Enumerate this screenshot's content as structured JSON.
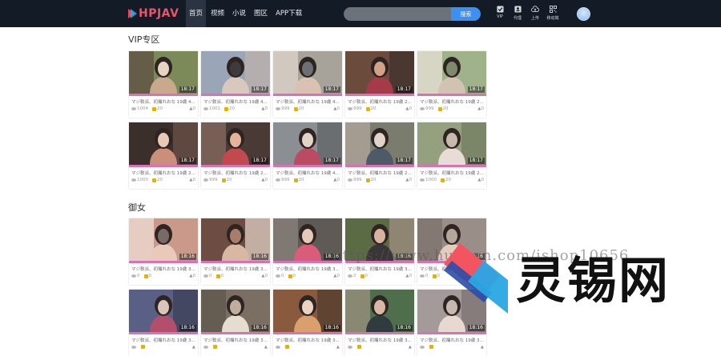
{
  "header": {
    "logo": "HPJAV",
    "nav": [
      "首页",
      "视频",
      "小说",
      "图区",
      "APP下载"
    ],
    "search_placeholder": "",
    "search_button": "搜索",
    "tools": [
      {
        "label": "VIP",
        "icon": "vip-check-icon"
      },
      {
        "label": "代理",
        "icon": "agent-icon"
      },
      {
        "label": "上传",
        "icon": "upload-cloud-icon"
      },
      {
        "label": "移动端",
        "icon": "mobile-qr-icon"
      }
    ]
  },
  "sections": [
    {
      "title": "VIP专区",
      "cards": [
        {
          "duration": "18:17",
          "title": "マジ軟派、初撮れおな 19歳 4...",
          "views": "1004",
          "coins": "20",
          "likes": "0"
        },
        {
          "duration": "18:17",
          "title": "マジ軟派、初撮れおな 19歳 4...",
          "views": "1001",
          "coins": "20",
          "likes": "0"
        },
        {
          "duration": "18:17",
          "title": "マジ軟派、初撮れおな 19歳 4...",
          "views": "999",
          "coins": "20",
          "likes": "0"
        },
        {
          "duration": "18:17",
          "title": "マジ軟派、初撮れおな 19歳 2...",
          "views": "999",
          "coins": "20",
          "likes": "0"
        },
        {
          "duration": "18:17",
          "title": "マジ軟派、初撮れおな 19歳 2...",
          "views": "999",
          "coins": "20",
          "likes": "0"
        },
        {
          "duration": "18:17",
          "title": "マジ軟派、初撮れおな 19歳 2...",
          "views": "1000",
          "coins": "20",
          "likes": "0"
        },
        {
          "duration": "18:17",
          "title": "マジ軟派、初撮れおな 19歳 2...",
          "views": "999",
          "coins": "20",
          "likes": "0"
        },
        {
          "duration": "18:17",
          "title": "マジ軟派、初撮れおな 19歳 4...",
          "views": "999",
          "coins": "20",
          "likes": "0"
        },
        {
          "duration": "18:17",
          "title": "マジ軟派、初撮れおな 19歳 2...",
          "views": "999",
          "coins": "20",
          "likes": "0"
        },
        {
          "duration": "18:17",
          "title": "マジ軟派、初撮れおな 19歳 2...",
          "views": "1000",
          "coins": "20",
          "likes": "0"
        }
      ]
    },
    {
      "title": "御女",
      "cards": [
        {
          "duration": "18:16",
          "title": "マジ軟派、初撮れおな 19歳 3...",
          "views": "0",
          "coins": "0",
          "likes": "0"
        },
        {
          "duration": "18:16",
          "title": "マジ軟派、初撮れおな 19歳 3...",
          "views": "0",
          "coins": "0",
          "likes": "0"
        },
        {
          "duration": "18:16",
          "title": "マジ軟派、初撮れおな 19歳 3...",
          "views": "0",
          "coins": "0",
          "likes": "0"
        },
        {
          "duration": "18:16",
          "title": "マジ軟派、初撮れおな 19歳 3...",
          "views": "2",
          "coins": "0",
          "likes": "0"
        },
        {
          "duration": "18:16",
          "title": "マジ軟派、初撮れおな 19歳 3...",
          "views": "0",
          "coins": "0",
          "likes": "0"
        },
        {
          "duration": "18:16",
          "title": "マジ軟派、初撮れおな 19歳 3...",
          "views": "",
          "coins": "",
          "likes": ""
        },
        {
          "duration": "18:16",
          "title": "マジ軟派、初撮れおな 19歳 3...",
          "views": "",
          "coins": "",
          "likes": ""
        },
        {
          "duration": "18:16",
          "title": "マジ軟派、初撮れおな 19歳 3...",
          "views": "",
          "coins": "",
          "likes": ""
        },
        {
          "duration": "18:16",
          "title": "マジ軟派、初撮れおな 19歳 3...",
          "views": "",
          "coins": "",
          "likes": ""
        },
        {
          "duration": "18:16",
          "title": "マジ軟派、初撮れおな 19歳 3...",
          "views": "",
          "coins": "",
          "likes": ""
        }
      ]
    }
  ],
  "watermark": {
    "url_text": "https://www.huzhan.com/ishop10656",
    "brand": "灵锡网"
  },
  "colors": {
    "topbar": "#131b27",
    "accent": "#3d8ff0",
    "pink_strip": "#d871b5",
    "coin": "#e2b400"
  }
}
